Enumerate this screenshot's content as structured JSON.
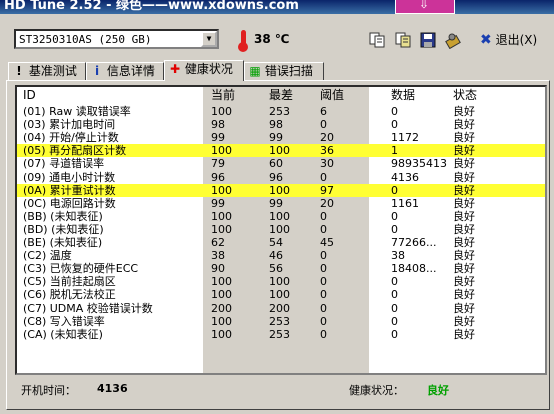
{
  "window": {
    "title": "HD Tune 2.52 - 绿色——www.xdowns.com"
  },
  "toolbar": {
    "drive": "ST3250310AS (250 GB)",
    "temperature": "38 ℃",
    "exit_label": "退出(X)"
  },
  "tabs": [
    {
      "label": "基准测试",
      "icon": "info-icon"
    },
    {
      "label": "信息详情",
      "icon": "info-icon"
    },
    {
      "label": "健康状况",
      "icon": "red-cross-icon"
    },
    {
      "label": "错误扫描",
      "icon": "green-scan-icon"
    }
  ],
  "columns": [
    "ID",
    "当前",
    "最差",
    "阈值",
    "数据",
    "状态"
  ],
  "rows": [
    {
      "id": "(01) Raw 读取错误率",
      "cur": "100",
      "worst": "253",
      "thr": "6",
      "data": "0",
      "status": "良好",
      "hl": false
    },
    {
      "id": "(03) 累计加电时间",
      "cur": "98",
      "worst": "98",
      "thr": "0",
      "data": "0",
      "status": "良好",
      "hl": false
    },
    {
      "id": "(04) 开始/停止计数",
      "cur": "99",
      "worst": "99",
      "thr": "20",
      "data": "1172",
      "status": "良好",
      "hl": false
    },
    {
      "id": "(05) 再分配扇区计数",
      "cur": "100",
      "worst": "100",
      "thr": "36",
      "data": "1",
      "status": "良好",
      "hl": true
    },
    {
      "id": "(07) 寻道错误率",
      "cur": "79",
      "worst": "60",
      "thr": "30",
      "data": "98935413",
      "status": "良好",
      "hl": false
    },
    {
      "id": "(09) 通电小时计数",
      "cur": "96",
      "worst": "96",
      "thr": "0",
      "data": "4136",
      "status": "良好",
      "hl": false
    },
    {
      "id": "(0A) 累计重试计数",
      "cur": "100",
      "worst": "100",
      "thr": "97",
      "data": "0",
      "status": "良好",
      "hl": true
    },
    {
      "id": "(0C) 电源回路计数",
      "cur": "99",
      "worst": "99",
      "thr": "20",
      "data": "1161",
      "status": "良好",
      "hl": false
    },
    {
      "id": "(BB) (未知表征)",
      "cur": "100",
      "worst": "100",
      "thr": "0",
      "data": "0",
      "status": "良好",
      "hl": false
    },
    {
      "id": "(BD) (未知表征)",
      "cur": "100",
      "worst": "100",
      "thr": "0",
      "data": "0",
      "status": "良好",
      "hl": false
    },
    {
      "id": "(BE) (未知表征)",
      "cur": "62",
      "worst": "54",
      "thr": "45",
      "data": "77266...",
      "status": "良好",
      "hl": false
    },
    {
      "id": "(C2) 温度",
      "cur": "38",
      "worst": "46",
      "thr": "0",
      "data": "38",
      "status": "良好",
      "hl": false
    },
    {
      "id": "(C3) 已恢复的硬件ECC",
      "cur": "90",
      "worst": "56",
      "thr": "0",
      "data": "18408...",
      "status": "良好",
      "hl": false
    },
    {
      "id": "(C5) 当前挂起扇区",
      "cur": "100",
      "worst": "100",
      "thr": "0",
      "data": "0",
      "status": "良好",
      "hl": false
    },
    {
      "id": "(C6) 脱机无法校正",
      "cur": "100",
      "worst": "100",
      "thr": "0",
      "data": "0",
      "status": "良好",
      "hl": false
    },
    {
      "id": "(C7) UDMA 校验错误计数",
      "cur": "200",
      "worst": "200",
      "thr": "0",
      "data": "0",
      "status": "良好",
      "hl": false
    },
    {
      "id": "(C8) 写入错误率",
      "cur": "100",
      "worst": "253",
      "thr": "0",
      "data": "0",
      "status": "良好",
      "hl": false
    },
    {
      "id": "(CA) (未知表征)",
      "cur": "100",
      "worst": "253",
      "thr": "0",
      "data": "0",
      "status": "良好",
      "hl": false
    }
  ],
  "footer": {
    "power_on_label": "开机时间：",
    "power_on_value": "4136",
    "health_label": "健康状况：",
    "health_value": "良好"
  },
  "colors": {
    "highlight": "#ffff33",
    "good": "#00a000",
    "title_bar": "#0a246a"
  }
}
